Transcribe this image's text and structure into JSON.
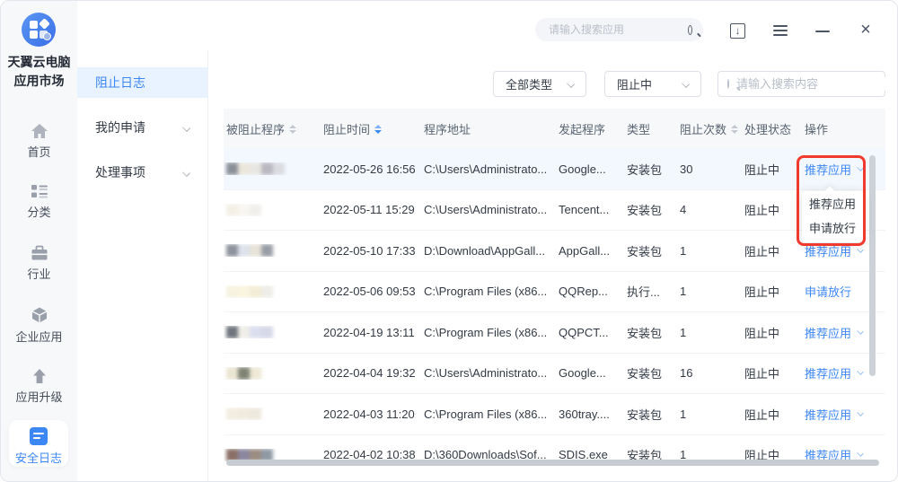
{
  "app": {
    "title_line1": "天翼云电脑",
    "title_line2": "应用市场"
  },
  "titlebar": {
    "search_placeholder": "请输入搜索应用"
  },
  "rail": {
    "items": [
      {
        "label": "首页",
        "icon": "home-icon"
      },
      {
        "label": "分类",
        "icon": "category-icon"
      },
      {
        "label": "行业",
        "icon": "briefcase-icon"
      },
      {
        "label": "企业应用",
        "icon": "cube-icon"
      },
      {
        "label": "应用升级",
        "icon": "upgrade-icon"
      },
      {
        "label": "安全日志",
        "icon": "security-log-icon",
        "active": true
      }
    ]
  },
  "sidebar": {
    "items": [
      {
        "label": "阻止日志",
        "active": true,
        "expandable": false
      },
      {
        "label": "我的申请",
        "active": false,
        "expandable": true
      },
      {
        "label": "处理事项",
        "active": false,
        "expandable": true
      }
    ]
  },
  "filters": {
    "type_select": "全部类型",
    "status_select": "阻止中",
    "search_placeholder": "请输入搜索内容"
  },
  "table": {
    "columns": [
      {
        "label": "被阻止程序",
        "sortable": true,
        "sort": "none"
      },
      {
        "label": "阻止时间",
        "sortable": true,
        "sort": "desc"
      },
      {
        "label": "程序地址",
        "sortable": false
      },
      {
        "label": "发起程序",
        "sortable": false
      },
      {
        "label": "类型",
        "sortable": false
      },
      {
        "label": "阻止次数",
        "sortable": true,
        "sort": "none"
      },
      {
        "label": "处理状态",
        "sortable": false
      },
      {
        "label": "操作",
        "sortable": false
      }
    ],
    "rows": [
      {
        "time": "2022-05-26 16:56",
        "path": "C:\\Users\\Administrato...",
        "source": "Google...",
        "type": "安装包",
        "count": "30",
        "status": "阻止中",
        "action": "推荐应用",
        "action_caret": true,
        "highlighted": true,
        "blur_blocks": [
          "#8b8f98",
          "#ece7dc",
          "#e9e7e3",
          "#bab8bf",
          "#dadbe0"
        ]
      },
      {
        "time": "2022-05-11 15:29",
        "path": "C:\\Users\\Administrato...",
        "source": "Tencent...",
        "type": "安装包",
        "count": "4",
        "status": "阻止中",
        "action": "",
        "action_caret": false,
        "highlighted": false,
        "blur_blocks": [
          "#f4f0e6",
          "#f8f6f1",
          "#f1efec"
        ]
      },
      {
        "time": "2022-05-10 17:33",
        "path": "D:\\Download\\AppGall...",
        "source": "AppGall...",
        "type": "安装包",
        "count": "1",
        "status": "阻止中",
        "action": "推荐应用",
        "action_caret": true,
        "highlighted": false,
        "blur_blocks": [
          "#8d939d",
          "#dde2eb",
          "#e7e3d9",
          "#989ea6"
        ]
      },
      {
        "time": "2022-05-06 09:53",
        "path": "C:\\Program Files (x86...",
        "source": "QQRep...",
        "type": "执行...",
        "count": "1",
        "status": "阻止中",
        "action": "申请放行",
        "action_caret": false,
        "highlighted": false,
        "blur_blocks": [
          "#f6f2e0",
          "#f9f5df",
          "#f3edd6",
          "#eeede8"
        ]
      },
      {
        "time": "2022-04-19 13:11",
        "path": "C:\\Program Files (x86...",
        "source": "QQPCT...",
        "type": "安装包",
        "count": "1",
        "status": "阻止中",
        "action": "推荐应用",
        "action_caret": true,
        "highlighted": false,
        "blur_blocks": [
          "#70757d",
          "#f0eee8",
          "#dbdeef",
          "#d7d9e9"
        ]
      },
      {
        "time": "2022-04-04 19:32",
        "path": "C:\\Users\\Administrato...",
        "source": "Google...",
        "type": "安装包",
        "count": "16",
        "status": "阻止中",
        "action": "推荐应用",
        "action_caret": true,
        "highlighted": false,
        "blur_blocks": [
          "#ebe5d3",
          "#7e8373",
          "#eee8d5"
        ]
      },
      {
        "time": "2022-04-03 11:20",
        "path": "C:\\Program Files (x86...",
        "source": "360tray....",
        "type": "安装包",
        "count": "1",
        "status": "阻止中",
        "action": "推荐应用",
        "action_caret": true,
        "highlighted": false,
        "blur_blocks": [
          "#f3eee1",
          "#f0ebdf",
          "#eee9de"
        ]
      },
      {
        "time": "2022-04-02 10:38",
        "path": "D:\\360Downloads\\Sof...",
        "source": "SDIS.exe",
        "type": "安装包",
        "count": "1",
        "status": "阻止中",
        "action": "推荐应用",
        "action_caret": true,
        "highlighted": false,
        "blur_blocks": [
          "#8a6f66",
          "#8b87a0",
          "#9c8d82",
          "#8f9aa5"
        ]
      }
    ]
  },
  "dropdown": {
    "items": [
      "推荐应用",
      "申请放行"
    ]
  },
  "colors": {
    "accent": "#3d87f5",
    "active_bg": "#e9f3ff",
    "annotation_red": "#f13a2e",
    "header_bg": "#f7f8fa",
    "row_highlight": "#f3f8fe"
  }
}
